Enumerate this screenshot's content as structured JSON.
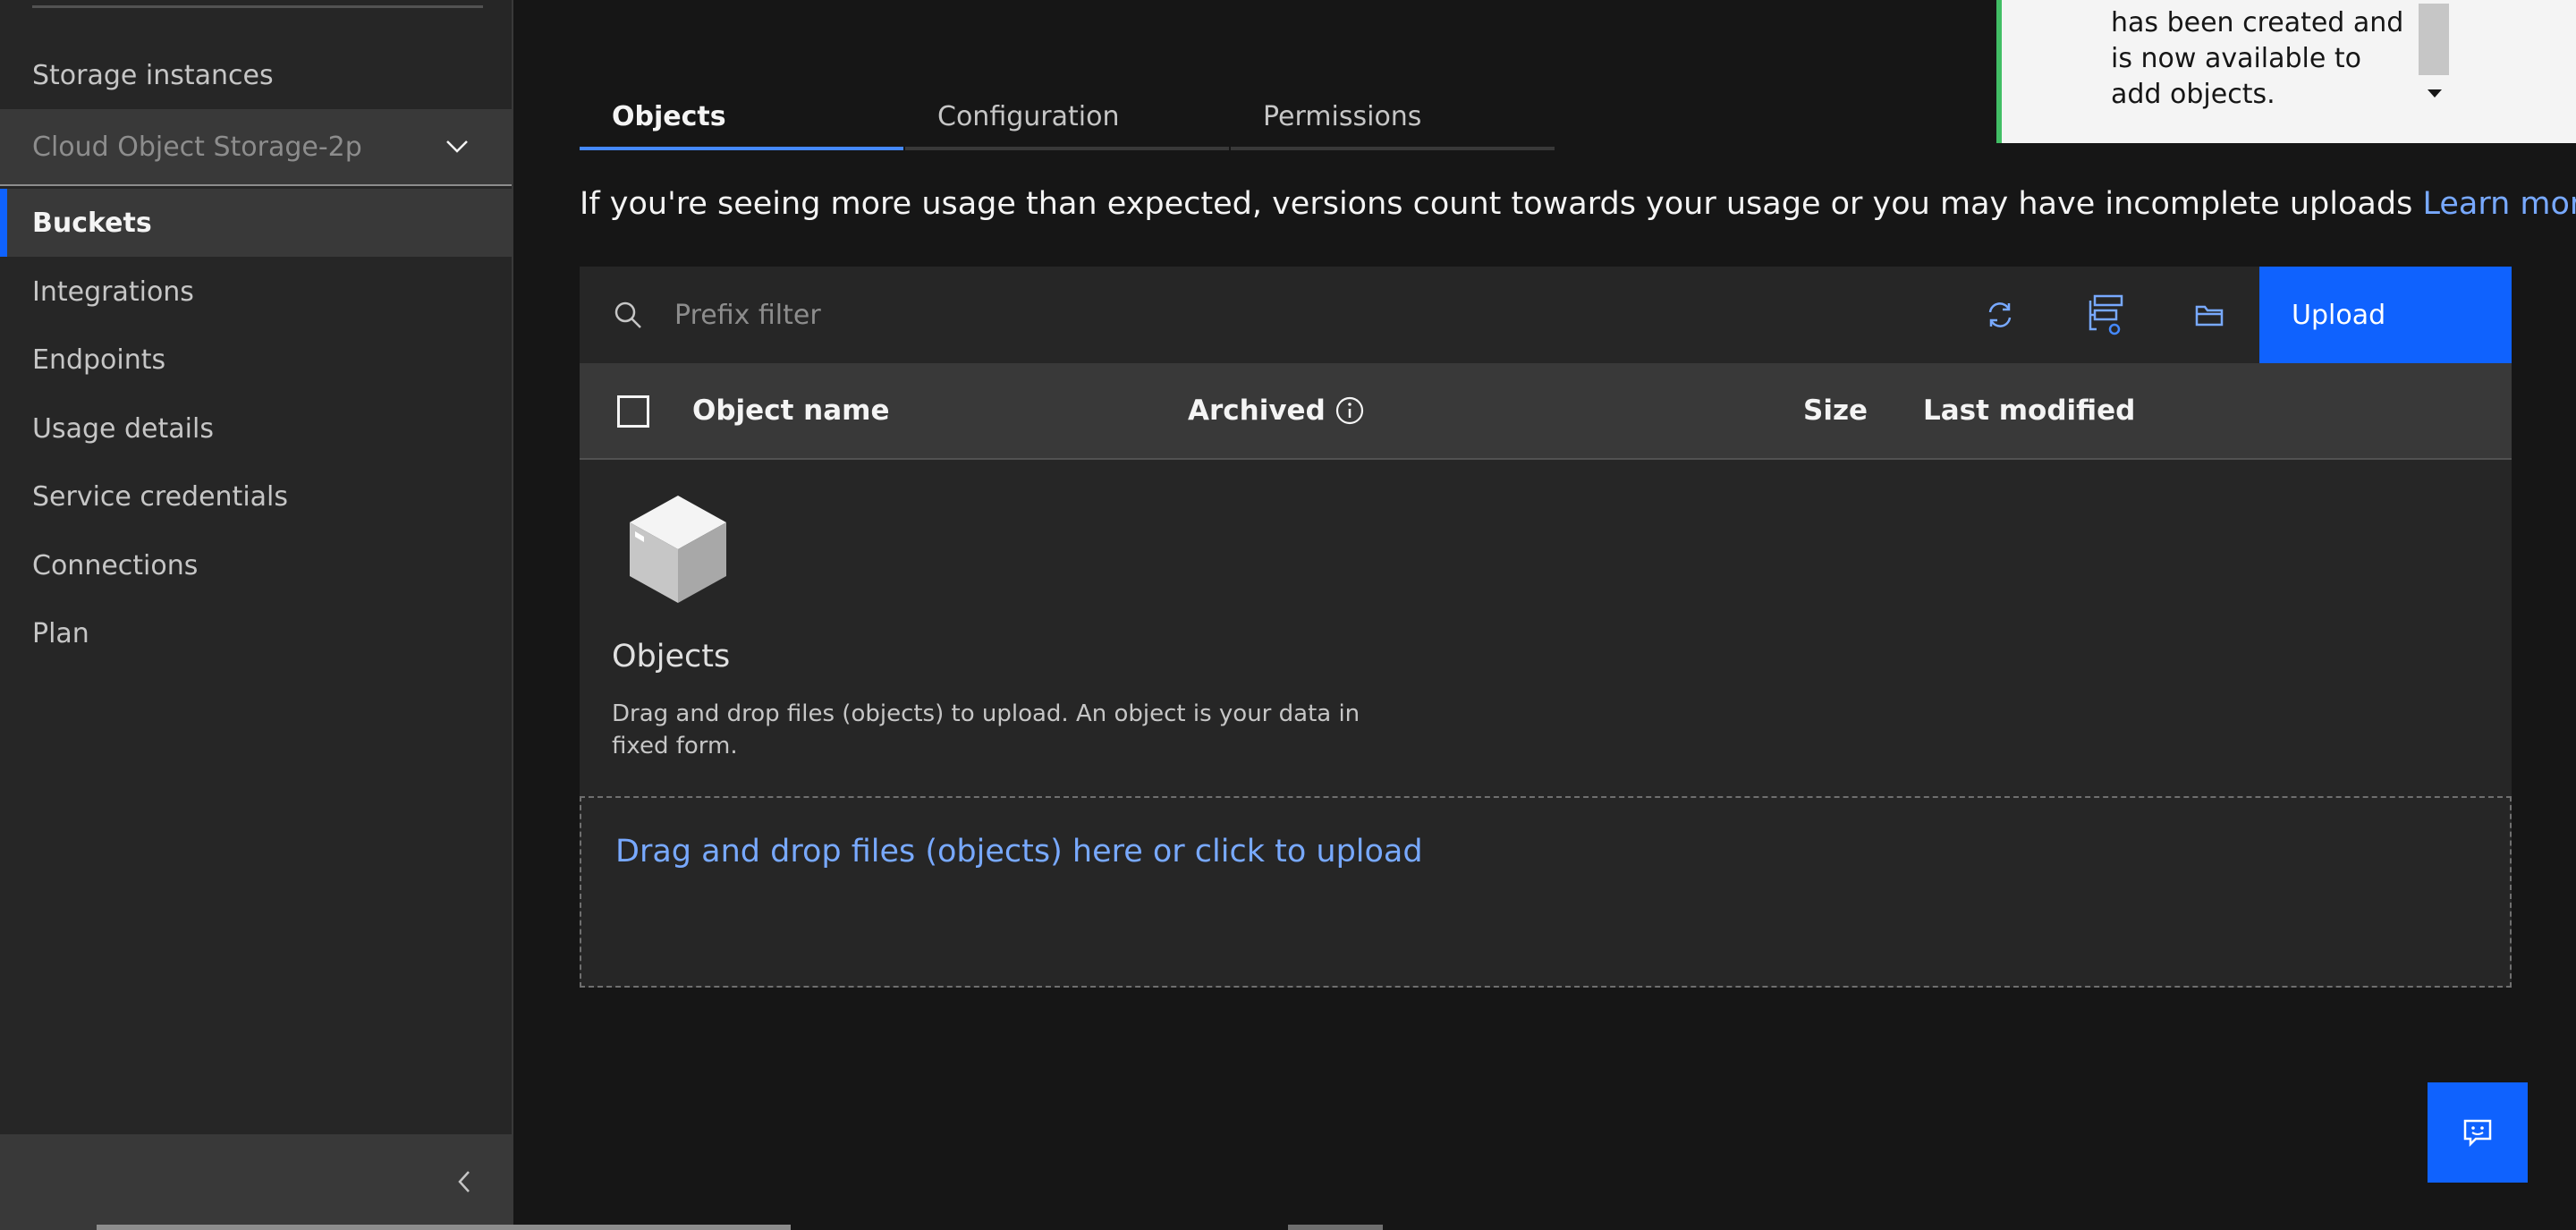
{
  "sidebar": {
    "items": [
      {
        "label": "Storage instances"
      },
      {
        "label": "Cloud Object Storage-2p"
      },
      {
        "label": "Buckets"
      },
      {
        "label": "Integrations"
      },
      {
        "label": "Endpoints"
      },
      {
        "label": "Usage details"
      },
      {
        "label": "Service credentials"
      },
      {
        "label": "Connections"
      },
      {
        "label": "Plan"
      }
    ],
    "active_item": "Buckets"
  },
  "tabs": [
    {
      "label": "Objects",
      "active": true
    },
    {
      "label": "Configuration",
      "active": false
    },
    {
      "label": "Permissions",
      "active": false
    }
  ],
  "info": {
    "message": "If you're seeing more usage than expected, versions count towards your usage or you may have incomplete uploads",
    "link_label": "Learn more"
  },
  "toolbar": {
    "search_placeholder": "Prefix filter",
    "upload_label": "Upload"
  },
  "table": {
    "columns": [
      "Object name",
      "Archived",
      "Size",
      "Last modified"
    ]
  },
  "empty_state": {
    "title": "Objects",
    "description": "Drag and drop files (objects) to upload. An object is your data in fixed form.",
    "dropzone_label": "Drag and drop files (objects) here or click to upload"
  },
  "toast": {
    "message": "has been created and is now available to add objects."
  },
  "colors": {
    "accent": "#0f62fe",
    "link": "#78a9ff",
    "success": "#42be65",
    "background": "#161616",
    "surface": "#262626"
  }
}
